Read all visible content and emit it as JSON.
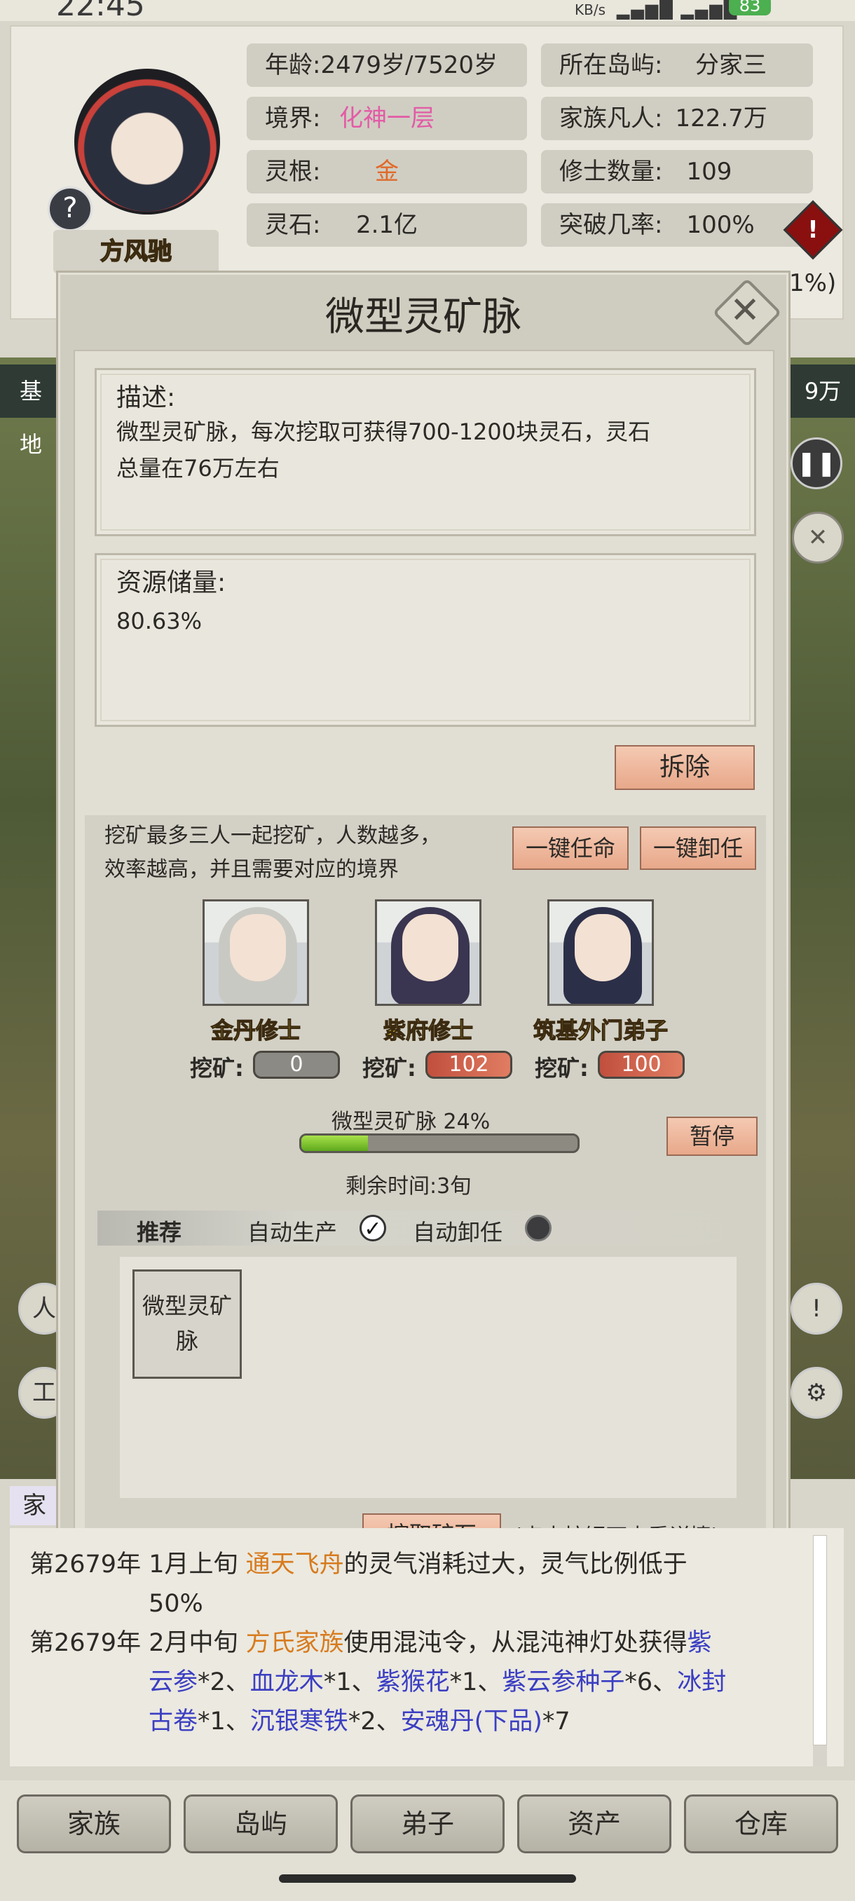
{
  "status_bar": {
    "time": "22:45",
    "net": "KB/s",
    "battery": "83"
  },
  "profile": {
    "name": "方风驰",
    "age_label": "年龄:",
    "age_value": "2479岁/7520岁",
    "realm_label": "境界:",
    "realm_value": "化神一层",
    "root_label": "灵根:",
    "root_value": "金",
    "stones_label": "灵石:",
    "stones_value": "2.1亿",
    "island_label": "所在岛屿:",
    "island_value": "分家三",
    "mortals_label": "家族凡人:",
    "mortals_value": "122.7万",
    "cultivators_label": "修士数量:",
    "cultivators_value": "109",
    "breakthrough_label": "突破几率:",
    "breakthrough_value": "100%",
    "partial_right": "1%)"
  },
  "background": {
    "left_label": "基地",
    "right_label": "9万",
    "family_tab": "家"
  },
  "modal": {
    "title": "微型灵矿脉",
    "desc_title": "描述:",
    "desc_text_1": "微型灵矿脉，每次挖取可获得700-1200块灵石，灵石",
    "desc_text_2": "总量在76万左右",
    "reserve_title": "资源储量:",
    "reserve_value": "80.63%",
    "demolish_label": "拆除",
    "mine_info_1": "挖矿最多三人一起挖矿，人数越多，",
    "mine_info_2": "效率越高，并且需要对应的境界",
    "appoint_all_label": "一键任命",
    "dismiss_all_label": "一键卸任",
    "workers": [
      {
        "title": "金丹修士",
        "mine_label": "挖矿:",
        "mine_value": "0"
      },
      {
        "title": "紫府修士",
        "mine_label": "挖矿:",
        "mine_value": "102"
      },
      {
        "title": "筑基外门弟子",
        "mine_label": "挖矿:",
        "mine_value": "100"
      }
    ],
    "progress_label": "微型灵矿脉 24%",
    "progress": 0.24,
    "remaining_label": "剩余时间:3旬",
    "pause_label": "暂停",
    "recommend_label": "推荐",
    "auto_produce_label": "自动生产",
    "auto_dismiss_label": "自动卸任",
    "rec_item_1": "微型灵矿",
    "rec_item_2": "脉",
    "dig_button_label": "挖取矿石",
    "dig_hint": "(点击按钮可查看详情)"
  },
  "log": {
    "l1_prefix": "第2679年 1月上旬",
    "l1_item": "通天飞舟",
    "l1_rest": "的灵气消耗过大，灵气比例低于",
    "l1_cont": "50%",
    "l2_prefix": "第2679年",
    "l2_time": "2月中旬",
    "l2_family": "方氏家族",
    "l2_rest": "使用混沌令，从混沌神灯处获得",
    "l2_i1": "紫",
    "l2_i1b": "云参",
    "l2_c1": "*2、",
    "l2_i2": "血龙木",
    "l2_c2": "*1、",
    "l2_i3": "紫猴花",
    "l2_c3": "*1、",
    "l2_i4": "紫云参种子",
    "l2_c4": "*6、",
    "l2_i5": "冰封",
    "l2_i5b": "古卷",
    "l2_c5": "*1、",
    "l2_i6": "沉银寒铁",
    "l2_c6": "*2、",
    "l2_i7": "安魂丹(下品)",
    "l2_c7": "*7"
  },
  "nav": [
    "家族",
    "岛屿",
    "弟子",
    "资产",
    "仓库"
  ],
  "colors": {
    "realm": "#e35ba6",
    "root": "#e06a2a",
    "accent_salmon": "#eaa98c",
    "progress_green": "#7cc530"
  }
}
